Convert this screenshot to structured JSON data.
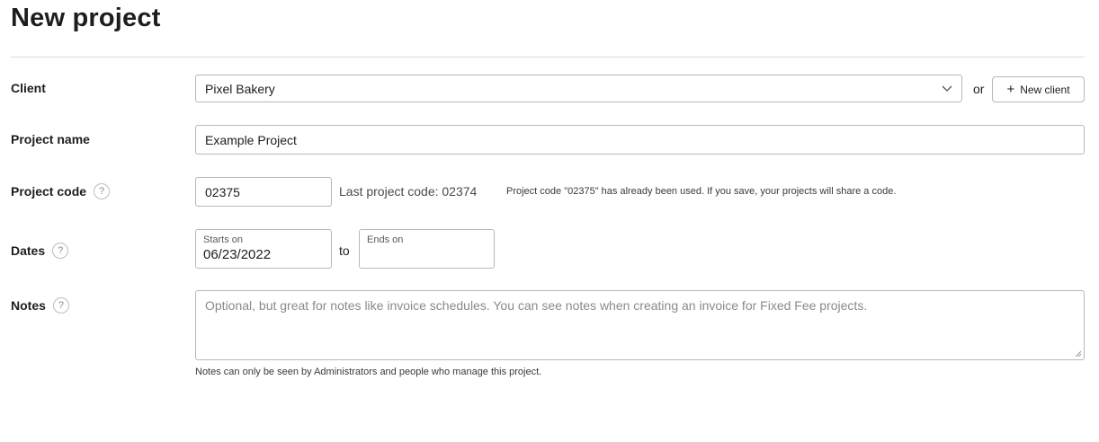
{
  "page": {
    "title": "New project"
  },
  "client": {
    "label": "Client",
    "selected": "Pixel Bakery",
    "or_text": "or",
    "new_client_label": "New client"
  },
  "project_name": {
    "label": "Project name",
    "value": "Example Project"
  },
  "project_code": {
    "label": "Project code",
    "help": "?",
    "value": "02375",
    "last_code": "Last project code: 02374",
    "warning": "Project code \"02375\" has already been used. If you save, your projects will share a code."
  },
  "dates": {
    "label": "Dates",
    "help": "?",
    "starts_label": "Starts on",
    "starts_value": "06/23/2022",
    "to_text": "to",
    "ends_label": "Ends on",
    "ends_value": ""
  },
  "notes": {
    "label": "Notes",
    "help": "?",
    "placeholder": "Optional, but great for notes like invoice schedules. You can see notes when creating an invoice for Fixed Fee projects.",
    "hint": "Notes can only be seen by Administrators and people who manage this project."
  }
}
